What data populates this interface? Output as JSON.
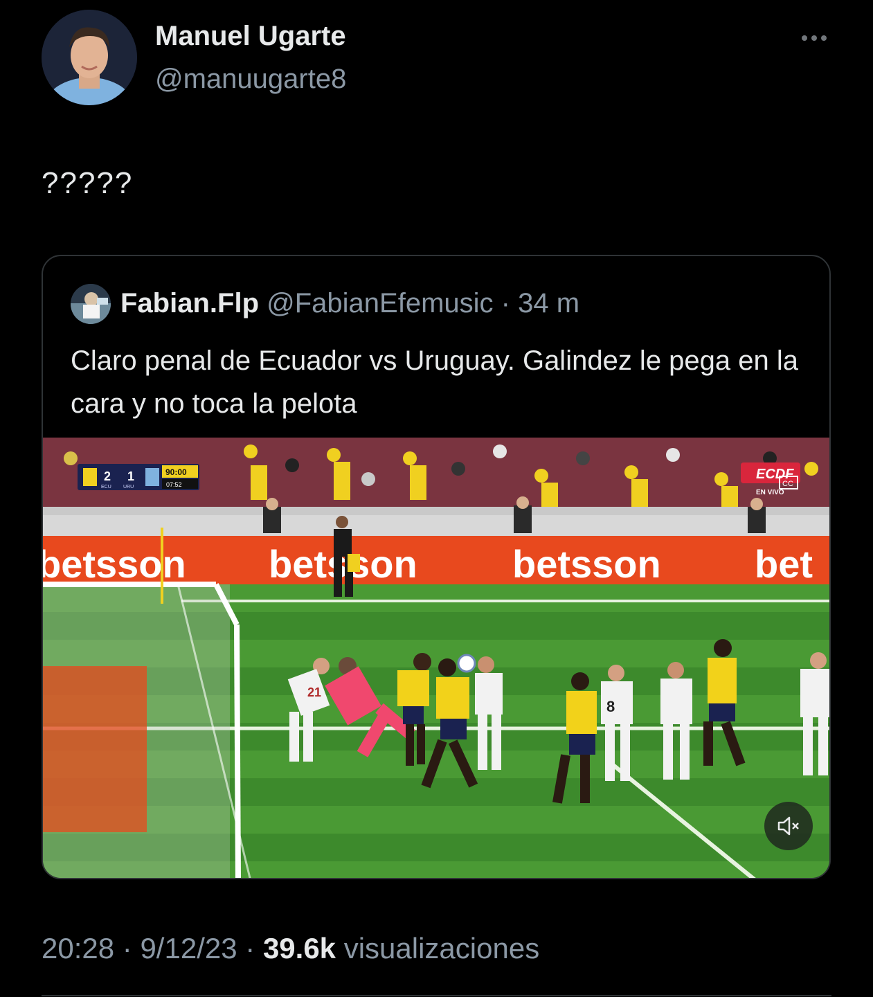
{
  "tweet": {
    "author_name": "Manuel Ugarte",
    "author_handle": "@manuugarte8",
    "text": "?????",
    "more_icon": "more-horizontal-icon",
    "time": "20:28",
    "date": "9/12/23",
    "views_count": "39.6k",
    "views_label": "visualizaciones",
    "separator": "·"
  },
  "quote": {
    "author_name": "Fabian.Flp",
    "author_handle": "@FabianEfemusic",
    "separator": "·",
    "time_ago": "34 m",
    "text": "Claro penal de Ecuador vs Uruguay. Galindez le pega en la cara y no toca la pelota",
    "media": {
      "scoreboard": {
        "home_score": "2",
        "away_score": "1",
        "home_team": "ECU",
        "away_team": "URU",
        "clock": "90:00",
        "added": "07:52"
      },
      "broadcaster": "ECDF",
      "broadcaster_sub": "EN VIVO",
      "cc": "CC",
      "ad_text": "betsson",
      "ad_partial": "bet",
      "player_numbers": [
        "21",
        "8"
      ],
      "mute_icon": "volume-mute-icon"
    }
  },
  "colors": {
    "background": "#000000",
    "text_primary": "#e7e9ea",
    "text_secondary": "#8b98a5",
    "border": "#2f3336",
    "pitch": "#3d8a2c",
    "ad_board": "#e8491e",
    "keeper_kit": "#f0486e",
    "ecuador_kit": "#f2d21a",
    "uruguay_kit": "#f2f2f2"
  }
}
